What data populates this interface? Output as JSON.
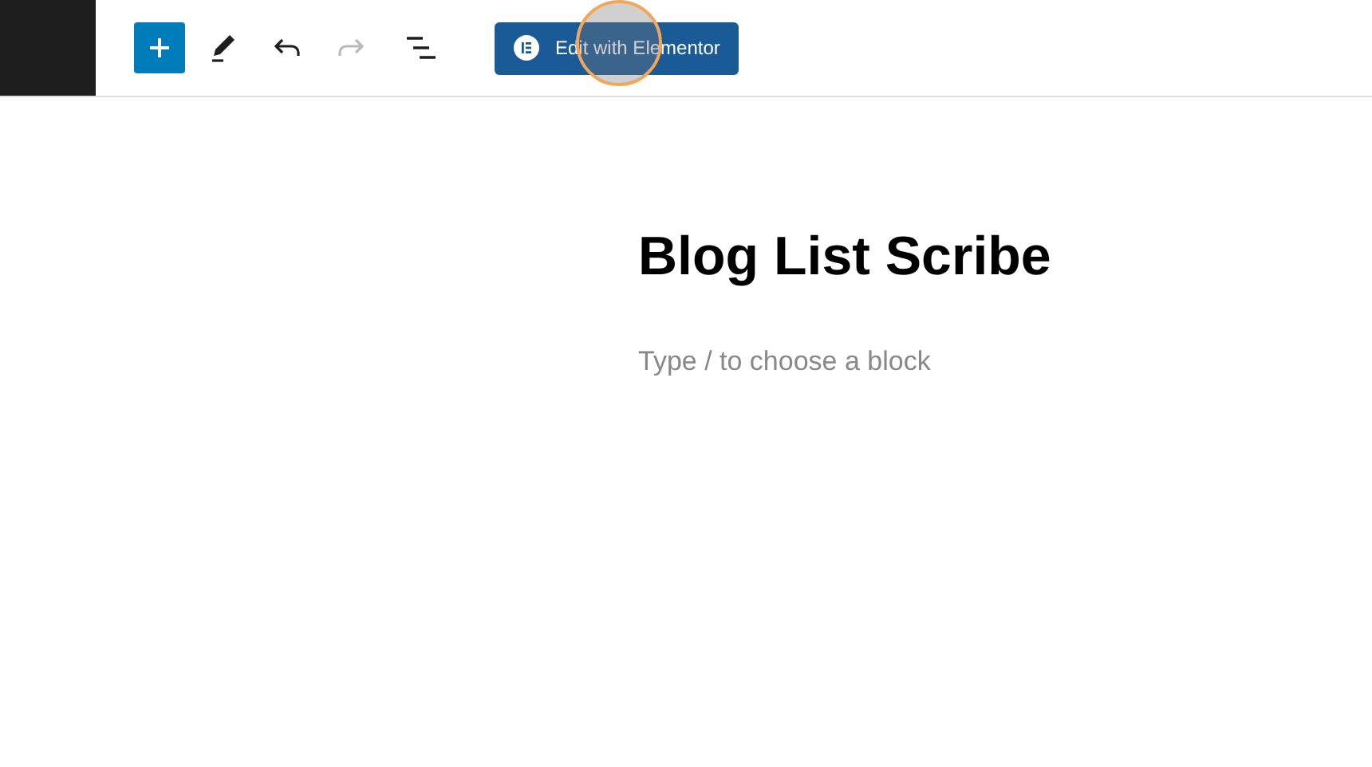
{
  "toolbar": {
    "tools": [
      {
        "kind": "add",
        "disabled": false
      },
      {
        "kind": "pen",
        "disabled": false
      },
      {
        "kind": "undo",
        "disabled": false
      },
      {
        "kind": "redo",
        "disabled": true
      },
      {
        "kind": "outline",
        "disabled": false
      }
    ],
    "elementor_button": {
      "label": "Edit with Elementor"
    },
    "click_indicator": true
  },
  "editor": {
    "title": "Blog List Scribe",
    "block_placeholder": "Type / to choose a block"
  }
}
